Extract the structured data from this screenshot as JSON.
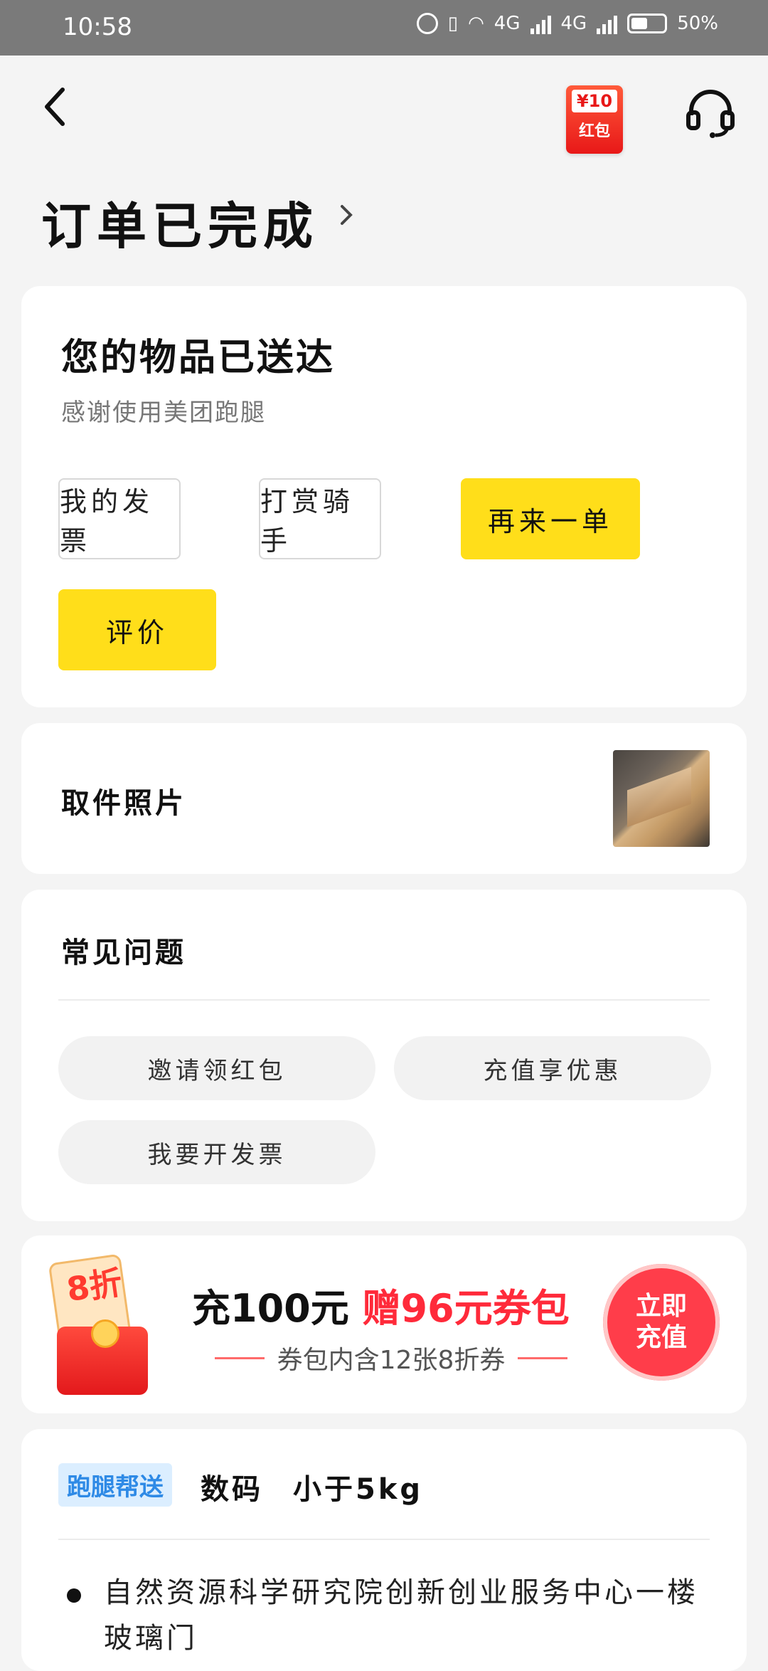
{
  "status_bar": {
    "time": "10:58",
    "network_1": "4G",
    "network_2": "4G",
    "battery": "50%"
  },
  "header": {
    "redpack_amount": "¥10",
    "redpack_label": "红包",
    "title": "订单已完成"
  },
  "status_card": {
    "heading": "您的物品已送达",
    "subtitle": "感谢使用美团跑腿",
    "buttons": {
      "invoice": "我的发票",
      "tip": "打赏骑手",
      "reorder": "再来一单",
      "review": "评价"
    }
  },
  "photo_card": {
    "label": "取件照片"
  },
  "faq_card": {
    "label": "常见问题",
    "items": [
      "邀请领红包",
      "充值享优惠",
      "我要开发票"
    ]
  },
  "promo": {
    "badge_text": "8折",
    "main_black": "充100元",
    "main_red": "赠96元券包",
    "sub": "券包内含12张8折券",
    "button": "立即充值"
  },
  "order_card": {
    "tag": "跑腿帮送",
    "goods": "数码",
    "weight": "小于5kg",
    "address": "自然资源科学研究院创新创业服务中心一楼玻璃门"
  },
  "colors": {
    "accent_yellow": "#ffde1a",
    "promo_red": "#ff2a3a",
    "tag_blue": "#2e8ae6"
  }
}
